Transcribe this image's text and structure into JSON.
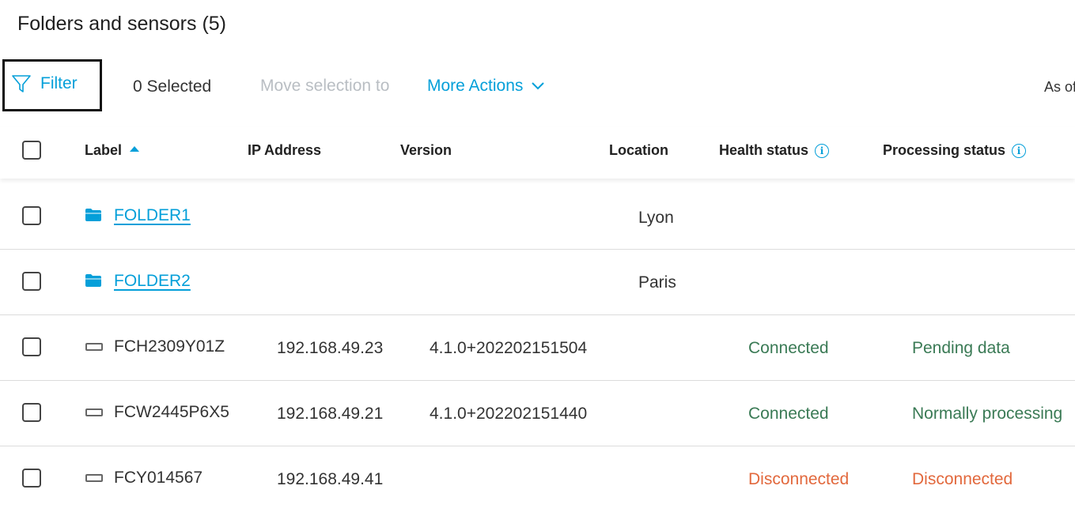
{
  "page": {
    "title": "Folders and sensors (5)"
  },
  "toolbar": {
    "filter_label": "Filter",
    "selected_label": "0 Selected",
    "move_label": "Move selection to",
    "more_actions_label": "More Actions",
    "as_of_label": "As of"
  },
  "table": {
    "columns": {
      "label": "Label",
      "ip": "IP Address",
      "version": "Version",
      "location": "Location",
      "health": "Health status",
      "processing": "Processing status"
    },
    "rows": [
      {
        "type": "folder",
        "label": "FOLDER1",
        "ip": "",
        "version": "",
        "location": "Lyon",
        "health": "",
        "processing": ""
      },
      {
        "type": "folder",
        "label": "FOLDER2",
        "ip": "",
        "version": "",
        "location": "Paris",
        "health": "",
        "processing": ""
      },
      {
        "type": "sensor",
        "label": "FCH2309Y01Z",
        "ip": "192.168.49.23",
        "version": "4.1.0+202202151504",
        "location": "",
        "health": "Connected",
        "processing": "Pending data"
      },
      {
        "type": "sensor",
        "label": "FCW2445P6X5",
        "ip": "192.168.49.21",
        "version": "4.1.0+202202151440",
        "location": "",
        "health": "Connected",
        "processing": "Normally processing"
      },
      {
        "type": "sensor",
        "label": "FCY014567",
        "ip": "192.168.49.41",
        "version": "",
        "location": "",
        "health": "Disconnected",
        "processing": "Disconnected"
      }
    ]
  },
  "colors": {
    "accent": "#049fd9",
    "status_ok": "#3a7a55",
    "status_error": "#e2683c"
  },
  "icons": {
    "filter": "funnel-icon",
    "folder": "folder-icon",
    "sensor": "sensor-icon",
    "info": "info-icon",
    "sort": "sort-ascending-icon",
    "chevron": "chevron-down-icon"
  }
}
